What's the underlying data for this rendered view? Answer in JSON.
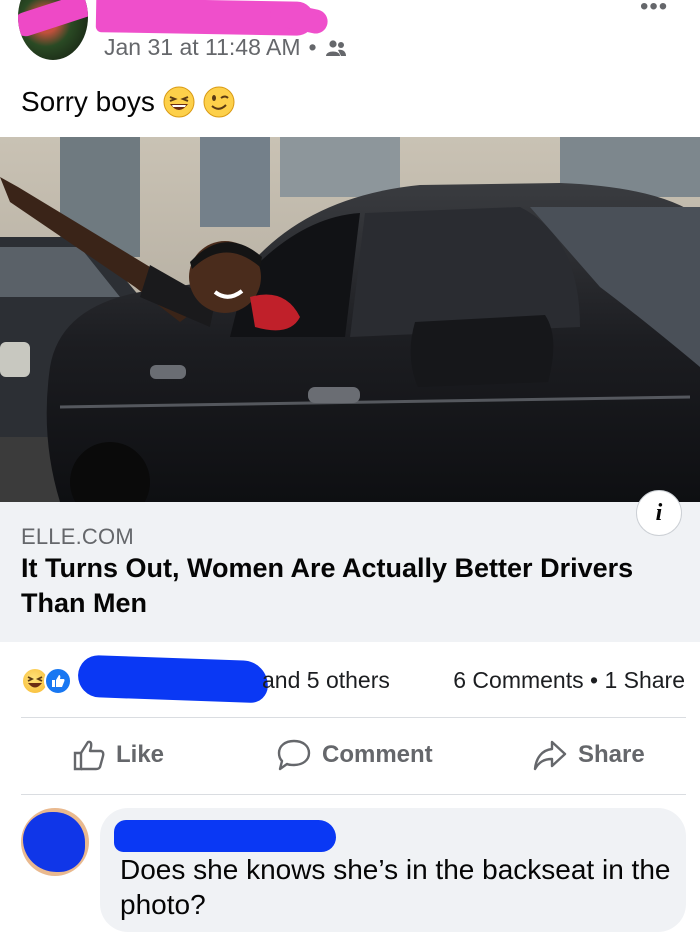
{
  "post": {
    "timestamp": "Jan 31 at 11:48 AM",
    "separator": "•",
    "audience_icon": "friends-icon",
    "text": "Sorry boys",
    "emojis": [
      "grinning-squinting-face",
      "winking-face"
    ]
  },
  "link_preview": {
    "domain": "ELLE.COM",
    "title": "It Turns Out, Women Are Actually Better Drivers Than Men",
    "info_label": "i"
  },
  "reactions": {
    "icons": [
      "haha-reaction-icon",
      "like-reaction-icon"
    ],
    "others_text": "and 5 others",
    "counts_text": "6 Comments • 1 Share"
  },
  "actions": {
    "like": "Like",
    "comment": "Comment",
    "share": "Share"
  },
  "comment": {
    "text": "Does she knows she’s in the backseat in the photo?"
  },
  "colors": {
    "redaction_pink": "#ef4fcb",
    "redaction_blue": "#0a38f4",
    "link_box_bg": "#f0f2f5",
    "muted_text": "#65676b"
  }
}
